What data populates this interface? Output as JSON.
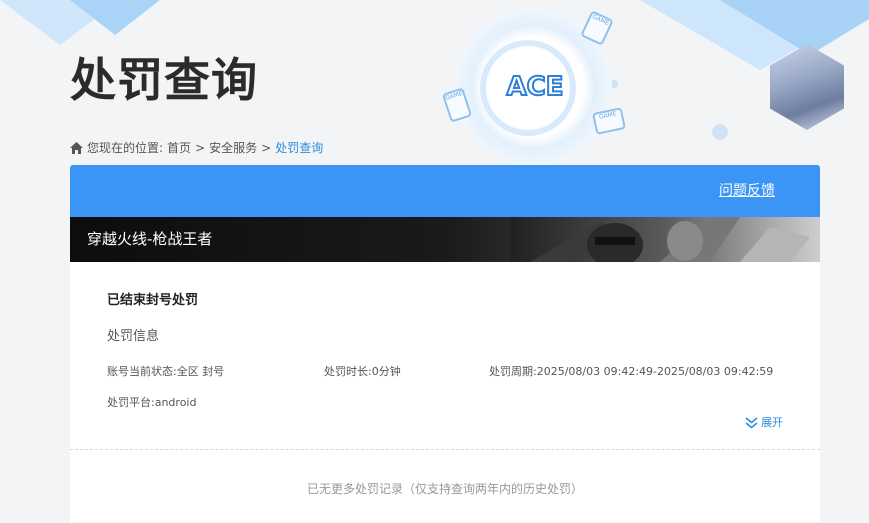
{
  "header": {
    "title": "处罚查询",
    "logo_text": "ACE",
    "device_label": "GAME"
  },
  "breadcrumb": {
    "prefix": "您现在的位置:",
    "items": [
      "首页",
      ">",
      "安全服务",
      ">",
      "处罚查询"
    ]
  },
  "toolbar": {
    "feedback_label": "问题反馈"
  },
  "game": {
    "name": "穿越火线-枪战王者"
  },
  "record": {
    "title": "已结束封号处罚",
    "section_label": "处罚信息",
    "status_label": "账号当前状态:",
    "status_value": "全区 封号",
    "duration_label": "处罚时长:",
    "duration_value": "0分钟",
    "period_label": "处罚周期:",
    "period_value": "2025/08/03 09:42:49-2025/08/03 09:42:59",
    "platform_label": "处罚平台:",
    "platform_value": "android",
    "expand_label": "展开"
  },
  "footer": {
    "no_more_text": "已无更多处罚记录（仅支持查询两年内的历史处罚）"
  },
  "colors": {
    "accent": "#3a95f5",
    "link": "#2b8de0",
    "background": "#f3f4f6"
  }
}
